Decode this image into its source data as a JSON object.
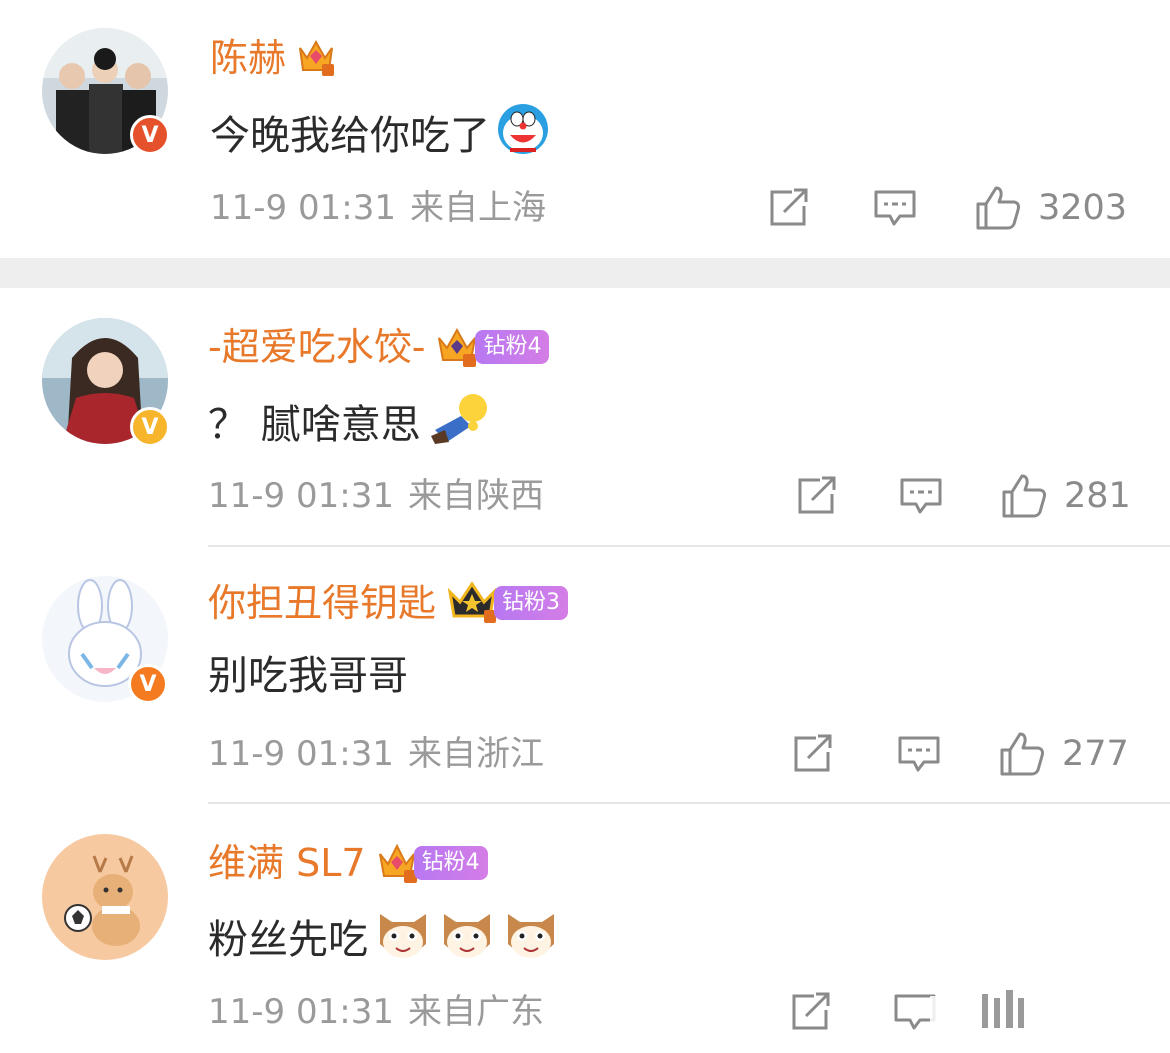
{
  "comments": [
    {
      "username": "陈赫",
      "text": "今晚我给你吃了",
      "emoji": [
        "doraemon-emoji"
      ],
      "time": "11-9 01:31",
      "location": "来自上海",
      "likes": "3203",
      "badge_color": "#e5512a",
      "verified_icon": "v-verified-icon"
    },
    {
      "username": "-超爱吃水饺-",
      "fan_badge": "钻粉4",
      "text": "？ 腻啥意思",
      "emoji": [
        "lying-down-emoji"
      ],
      "time": "11-9 01:31",
      "location": "来自陕西",
      "likes": "281",
      "badge_color": "#f7b52c",
      "verified_icon": "v-verified-icon"
    },
    {
      "username": "你担丑得钥匙",
      "fan_badge": "钻粉3",
      "text": "别吃我哥哥",
      "emoji": [],
      "time": "11-9 01:31",
      "location": "来自浙江",
      "likes": "277",
      "badge_color": "#f57b20",
      "verified_icon": "v-verified-icon"
    },
    {
      "username": "维满 SL7",
      "fan_badge": "钻粉4",
      "text": "粉丝先吃",
      "emoji": [
        "cat-face-emoji",
        "cat-face-emoji",
        "cat-face-emoji"
      ],
      "time": "11-9 01:31",
      "location": "来自广东",
      "likes": ""
    }
  ],
  "colors": {
    "username": "#e8782a",
    "meta": "#9a9a9a",
    "fan_badge": "#c17af0"
  }
}
